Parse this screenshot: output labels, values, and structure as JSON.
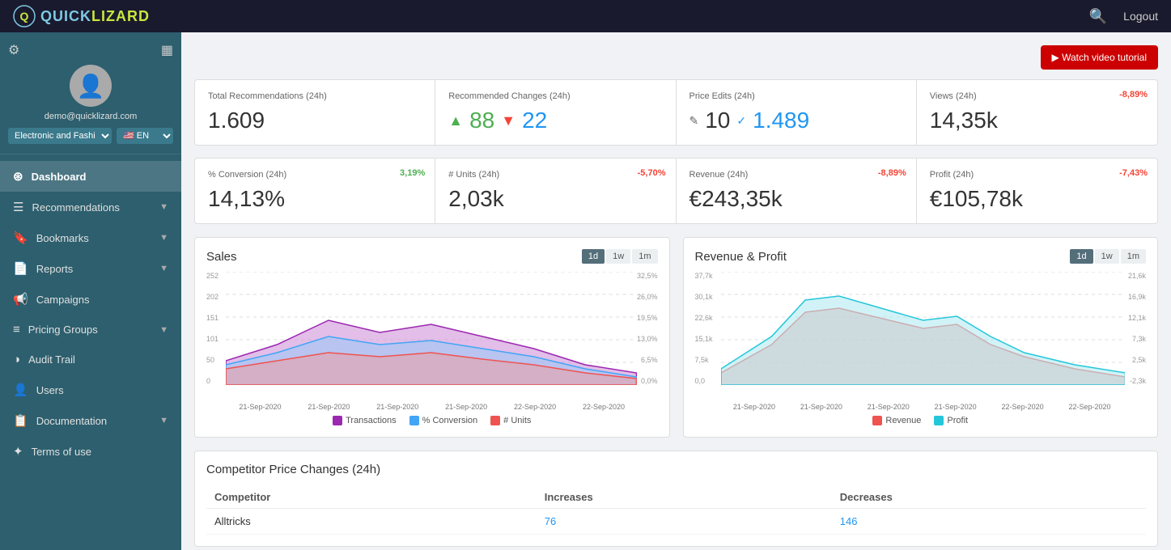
{
  "topnav": {
    "logo_text_quick": "QUICK",
    "logo_text_lizard": "LIZARD",
    "search_label": "🔍",
    "logout_label": "Logout"
  },
  "sidebar": {
    "user_email": "demo@quicklizard.com",
    "category_select": "Electronic and Fashi",
    "lang_select": "EN",
    "nav_items": [
      {
        "id": "dashboard",
        "icon": "⊞",
        "label": "Dashboard",
        "active": true,
        "has_chevron": false
      },
      {
        "id": "recommendations",
        "icon": "☰",
        "label": "Recommendations",
        "active": false,
        "has_chevron": true
      },
      {
        "id": "bookmarks",
        "icon": "🔖",
        "label": "Bookmarks",
        "active": false,
        "has_chevron": true
      },
      {
        "id": "reports",
        "icon": "📄",
        "label": "Reports",
        "active": false,
        "has_chevron": true
      },
      {
        "id": "campaigns",
        "icon": "📢",
        "label": "Campaigns",
        "active": false,
        "has_chevron": false
      },
      {
        "id": "pricing-groups",
        "icon": "≡",
        "label": "Pricing Groups",
        "active": false,
        "has_chevron": true
      },
      {
        "id": "audit-trail",
        "icon": "◑",
        "label": "Audit Trail",
        "active": false,
        "has_chevron": false
      },
      {
        "id": "users",
        "icon": "👤",
        "label": "Users",
        "active": false,
        "has_chevron": false
      },
      {
        "id": "documentation",
        "icon": "📋",
        "label": "Documentation",
        "active": false,
        "has_chevron": true
      },
      {
        "id": "terms",
        "icon": "✦",
        "label": "Terms of use",
        "active": false,
        "has_chevron": false
      }
    ]
  },
  "dashboard": {
    "watch_video_label": "▶ Watch video tutorial",
    "stats": [
      {
        "id": "total-recommendations",
        "label": "Total Recommendations (24h)",
        "value": "1.609",
        "delta": null,
        "delta_class": ""
      },
      {
        "id": "recommended-changes",
        "label": "Recommended Changes (24h)",
        "value_up": "88",
        "value_down": "22",
        "delta": null
      },
      {
        "id": "price-edits",
        "label": "Price Edits (24h)",
        "value_pencil": "10",
        "value_check": "1.489",
        "delta": null
      },
      {
        "id": "views",
        "label": "Views (24h)",
        "value": "14,35k",
        "delta": "-8,89%",
        "delta_class": "delta-red"
      }
    ],
    "stats2": [
      {
        "id": "conversion",
        "label": "% Conversion (24h)",
        "value": "14,13%",
        "delta": "3,19%",
        "delta_class": "delta-green"
      },
      {
        "id": "units",
        "label": "# Units (24h)",
        "value": "2,03k",
        "delta": "-5,70%",
        "delta_class": "delta-red"
      },
      {
        "id": "revenue",
        "label": "Revenue (24h)",
        "value": "€243,35k",
        "delta": "-8,89%",
        "delta_class": "delta-red"
      },
      {
        "id": "profit",
        "label": "Profit (24h)",
        "value": "€105,78k",
        "delta": "-7,43%",
        "delta_class": "delta-red"
      }
    ],
    "sales_chart": {
      "title": "Sales",
      "period_buttons": [
        "1d",
        "1w",
        "1m"
      ],
      "active_period": "1d",
      "y_left": [
        "252",
        "202",
        "151",
        "101",
        "50",
        "0"
      ],
      "y_right": [
        "32,5%",
        "26,0%",
        "19,5%",
        "13,0%",
        "6,5%",
        "0,0%"
      ],
      "x_labels": [
        "21-Sep-2020",
        "21-Sep-2020",
        "21-Sep-2020",
        "21-Sep-2020",
        "22-Sep-2020",
        "22-Sep-2020"
      ],
      "legend": [
        {
          "color": "#9c27b0",
          "label": "Transactions"
        },
        {
          "color": "#90caf9",
          "label": "% Conversion"
        },
        {
          "color": "#ef9a9a",
          "label": "# Units"
        }
      ]
    },
    "revenue_chart": {
      "title": "Revenue & Profit",
      "period_buttons": [
        "1d",
        "1w",
        "1m"
      ],
      "active_period": "1d",
      "y_left": [
        "37,7k",
        "30,1k",
        "22,6k",
        "15,1k",
        "7,5k",
        "0,0"
      ],
      "y_right": [
        "21,6k",
        "16,9k",
        "12,1k",
        "7,3k",
        "2,5k",
        "-2,3k"
      ],
      "x_labels": [
        "21-Sep-2020",
        "21-Sep-2020",
        "21-Sep-2020",
        "21-Sep-2020",
        "22-Sep-2020",
        "22-Sep-2020"
      ],
      "legend": [
        {
          "color": "#ef9a9a",
          "label": "Revenue"
        },
        {
          "color": "#80deea",
          "label": "Profit"
        }
      ]
    },
    "competitor_section": {
      "title": "Competitor Price Changes (24h)",
      "columns": [
        "Competitor",
        "Increases",
        "Decreases"
      ],
      "rows": [
        {
          "competitor": "Alltricks",
          "increases": "76",
          "decreases": "146"
        }
      ]
    }
  }
}
